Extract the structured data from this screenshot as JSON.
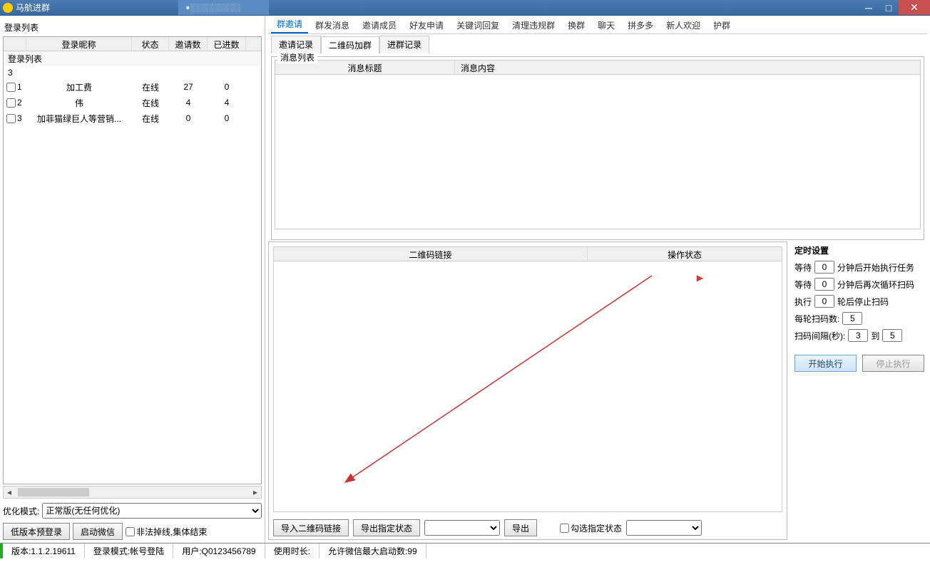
{
  "window": {
    "title": "马航进群",
    "bg_tab": "●"
  },
  "left": {
    "panel_title": "登录列表",
    "cols": {
      "nick": "登录昵称",
      "status": "状态",
      "inv": "邀请数",
      "joined": "已进数"
    },
    "group_label": "登录列表",
    "count": "3",
    "rows": [
      {
        "idx": "1",
        "nick": "加工费",
        "status": "在线",
        "inv": "27",
        "joined": "0"
      },
      {
        "idx": "2",
        "nick": "伟",
        "status": "在线",
        "inv": "4",
        "joined": "4"
      },
      {
        "idx": "3",
        "nick": "加菲猫绿巨人等营销...",
        "status": "在线",
        "inv": "0",
        "joined": "0"
      }
    ],
    "opt_label": "优化模式:",
    "opt_value": "正常版(无任何优化)",
    "btn_lowver": "低版本预登录",
    "btn_start": "启动微信",
    "cb_illegal": "非法掉线,集体结束"
  },
  "tabs": [
    "群邀请",
    "群发消息",
    "邀请成员",
    "好友申请",
    "关键词回复",
    "清理违规群",
    "换群",
    "聊天",
    "拼多多",
    "新人欢迎",
    "护群"
  ],
  "active_tab": 0,
  "subtabs": [
    "邀请记录",
    "二维码加群",
    "进群记录"
  ],
  "active_subtab": 1,
  "msg": {
    "legend": "消息列表",
    "col1": "消息标题",
    "col2": "消息内容"
  },
  "qr": {
    "col1": "二维码链接",
    "col2": "操作状态",
    "btn_import": "导入二维码链接",
    "btn_export_status": "导出指定状态",
    "btn_export": "导出",
    "cb_checkstatus": "勾选指定状态"
  },
  "timer": {
    "title": "定时设置",
    "r1a": "等待",
    "r1v": "0",
    "r1b": "分钟后开始执行任务",
    "r2a": "等待",
    "r2v": "0",
    "r2b": "分钟后再次循环扫码",
    "r3a": "执行",
    "r3v": "0",
    "r3b": "轮后停止扫码",
    "r4a": "每轮扫码数:",
    "r4v": "5",
    "r5a": "扫码间隔(秒):",
    "r5v1": "3",
    "r5m": "到",
    "r5v2": "5",
    "btn_start": "开始执行",
    "btn_stop": "停止执行"
  },
  "status": {
    "ver": "版本:1.1.2.19611",
    "mode": "登录模式:帐号登陆",
    "user": "用户:Q0123456789",
    "time": "使用时长:",
    "max": "允许微信最大启动数:99"
  }
}
